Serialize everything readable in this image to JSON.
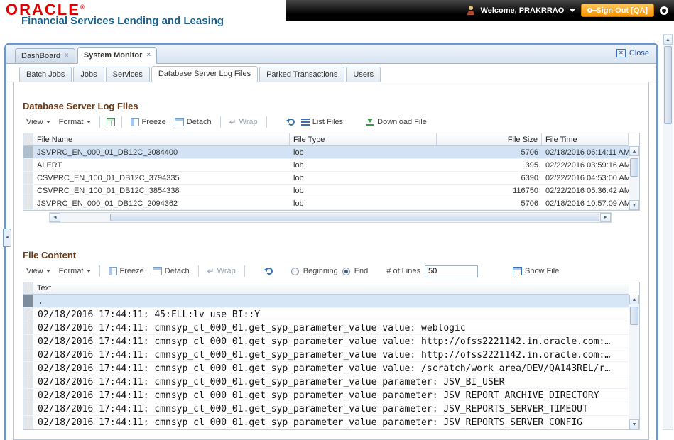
{
  "header": {
    "brand": "ORACLE",
    "registered": "®",
    "subtitle": "Financial Services Lending and Leasing",
    "welcome": "Welcome, PRAKRRAO",
    "sign_out_label": "Sign Out [QA]"
  },
  "window_tabs": {
    "dashboard": "DashBoard",
    "system_monitor": "System Monitor",
    "close_label": "Close"
  },
  "subtabs": {
    "batch_jobs": "Batch Jobs",
    "jobs": "Jobs",
    "services": "Services",
    "db_log_files": "Database Server Log Files",
    "parked_transactions": "Parked Transactions",
    "users": "Users"
  },
  "log_files": {
    "title": "Database Server Log Files",
    "toolbar": {
      "view": "View",
      "format": "Format",
      "freeze": "Freeze",
      "detach": "Detach",
      "wrap": "Wrap",
      "list_files": "List Files",
      "download_file": "Download File"
    },
    "columns": {
      "file_name": "File Name",
      "file_type": "File Type",
      "file_size": "File Size",
      "file_time": "File Time"
    },
    "rows": [
      {
        "file_name": "JSVPRC_EN_000_01_DB12C_2084400",
        "file_type": "lob",
        "file_size": "5706",
        "file_time": "02/18/2016 06:14:11 AM"
      },
      {
        "file_name": "ALERT",
        "file_type": "lob",
        "file_size": "395",
        "file_time": "02/22/2016 03:59:16 AM"
      },
      {
        "file_name": "CSVPRC_EN_100_01_DB12C_3794335",
        "file_type": "lob",
        "file_size": "6390",
        "file_time": "02/22/2016 04:53:00 AM"
      },
      {
        "file_name": "CSVPRC_EN_100_01_DB12C_3854338",
        "file_type": "lob",
        "file_size": "116750",
        "file_time": "02/22/2016 05:36:42 AM"
      },
      {
        "file_name": "JSVPRC_EN_000_01_DB12C_2094362",
        "file_type": "lob",
        "file_size": "5706",
        "file_time": "02/18/2016 10:57:09 AM"
      }
    ]
  },
  "file_content": {
    "title": "File Content",
    "toolbar": {
      "view": "View",
      "format": "Format",
      "freeze": "Freeze",
      "detach": "Detach",
      "wrap": "Wrap",
      "beginning": "Beginning",
      "end": "End",
      "num_lines_label": "# of Lines",
      "num_lines_value": "50",
      "show_file": "Show File"
    },
    "column_header": "Text",
    "lines": [
      ".",
      "02/18/2016 17:44:11: 45:FLL:lv_use_BI::Y",
      "02/18/2016 17:44:11: cmnsyp_cl_000_01.get_syp_parameter_value value: weblogic",
      "02/18/2016 17:44:11: cmnsyp_cl_000_01.get_syp_parameter_value value: http://ofss2221142.in.oracle.com:…",
      "02/18/2016 17:44:11: cmnsyp_cl_000_01.get_syp_parameter_value value: http://ofss2221142.in.oracle.com:…",
      "02/18/2016 17:44:11: cmnsyp_cl_000_01.get_syp_parameter_value value: /scratch/work_area/DEV/QA143REL/r…",
      "02/18/2016 17:44:11: cmnsyp_cl_000_01.get_syp_parameter_value parameter: JSV_BI_USER",
      "02/18/2016 17:44:11: cmnsyp_cl_000_01.get_syp_parameter_value parameter: JSV_REPORT_ARCHIVE_DIRECTORY",
      "02/18/2016 17:44:11: cmnsyp_cl_000_01.get_syp_parameter_value parameter: JSV_REPORTS_SERVER_TIMEOUT",
      "02/18/2016 17:44:11: cmnsyp_cl_000_01.get_syp_parameter_value parameter: JSV_REPORTS_SERVER_CONFIG"
    ]
  },
  "icons": {
    "tab_close": "×",
    "window_close": "✕",
    "wrap_arrow": "↵",
    "up_arrow": "▲",
    "down_arrow": "▼",
    "left_arrow": "◄",
    "right_arrow": "►",
    "collapse_left": "◄"
  },
  "colors": {
    "brand_red": "#e00000",
    "subtitle_blue": "#16618e",
    "signout_orange": "#f79400",
    "frame_blue": "#7296c0",
    "section_heading": "#6b3813",
    "selected_row": "#d3e3f5"
  }
}
